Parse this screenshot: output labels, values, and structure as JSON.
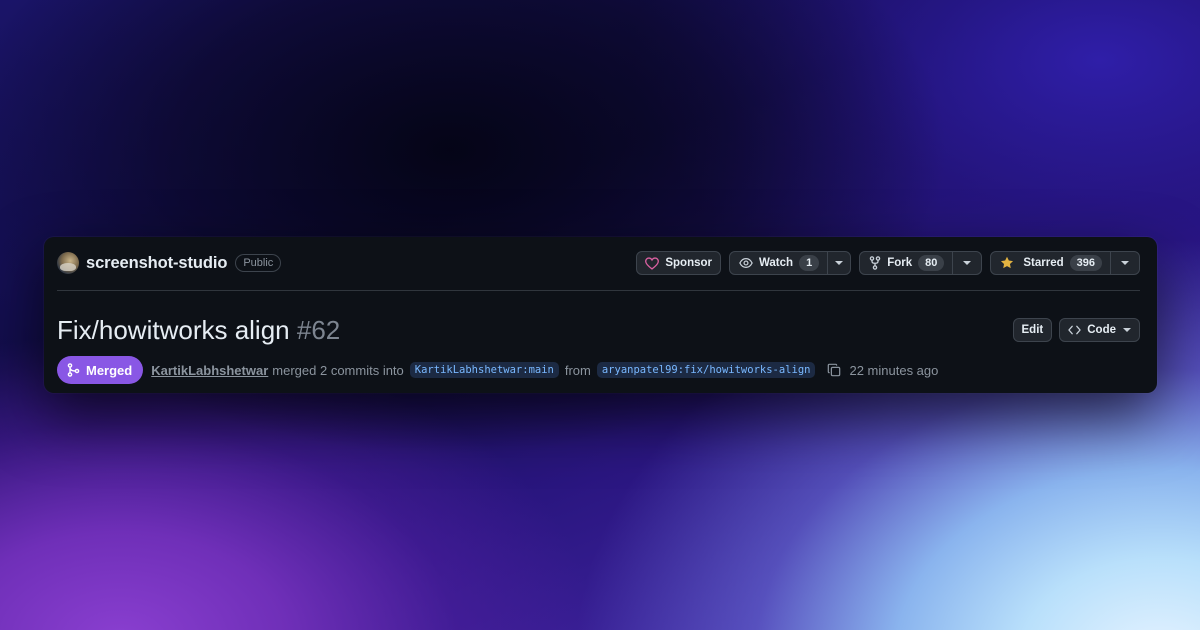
{
  "repo": {
    "name": "screenshot-studio",
    "visibility": "Public",
    "sponsor_label": "Sponsor",
    "watch": {
      "label": "Watch",
      "count": "1"
    },
    "fork": {
      "label": "Fork",
      "count": "80"
    },
    "star": {
      "label": "Starred",
      "count": "396"
    }
  },
  "pr": {
    "title": "Fix/howitworks align",
    "number": "#62",
    "edit_label": "Edit",
    "code_label": "Code",
    "status": "Merged",
    "author": "KartikLabhshetwar",
    "action_text": "merged 2 commits into",
    "base_branch": "KartikLabhshetwar:main",
    "from_text": "from",
    "head_branch": "aryanpatel99:fix/howitworks-align",
    "time": "22 minutes ago"
  },
  "colors": {
    "merged": "#8957e5",
    "star": "#e3b341",
    "sponsor_heart": "#db61a2",
    "branch_text": "#79b8ff"
  },
  "icons": [
    "avatar",
    "heart-icon",
    "eye-icon",
    "fork-icon",
    "star-icon",
    "chevron-down-icon",
    "code-icon",
    "merge-icon",
    "copy-icon"
  ]
}
